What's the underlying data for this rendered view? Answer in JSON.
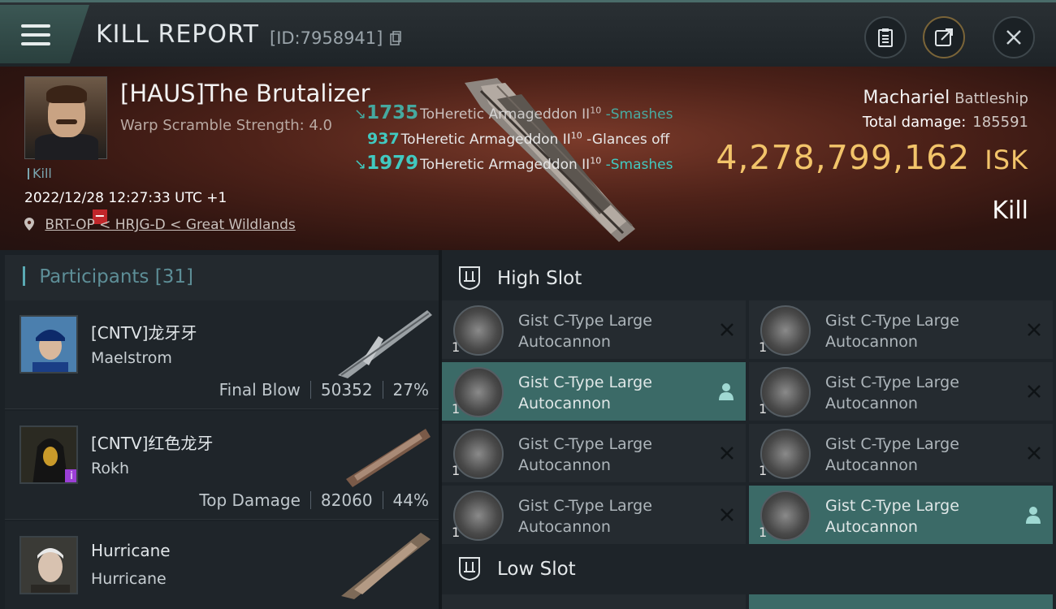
{
  "header": {
    "title": "KILL REPORT",
    "id_label": "[ID:7958941]"
  },
  "victim": {
    "name": "[HAUS]The Brutalizer",
    "subtitle": "Warp Scramble Strength: 4.0",
    "kill_tag": "Kill",
    "timestamp": "2022/12/28 12:27:33 UTC +1",
    "location": "BRT-OP < HRJG-D < Great Wildlands",
    "ship": "Machariel",
    "ship_class": "Battleship",
    "total_damage_label": "Total damage:",
    "total_damage": "185591",
    "isk_value": "4,278,799,162",
    "isk_unit": "ISK",
    "result": "Kill"
  },
  "damage_feed": [
    {
      "amount": "1735",
      "target": "ToHeretic Armageddon II",
      "level": "10",
      "verb": "-Smashes"
    },
    {
      "amount": "937",
      "target": "ToHeretic Armageddon II",
      "level": "10",
      "verb": "-Glances off"
    },
    {
      "amount": "1979",
      "target": "ToHeretic Armageddon II",
      "level": "10",
      "verb": "-Smashes"
    }
  ],
  "participants": {
    "label": "Participants",
    "count": "[31]",
    "rows": [
      {
        "name": "[CNTV]龙牙牙",
        "ship": "Maelstrom",
        "stat_label": "Final Blow",
        "damage": "50352",
        "percent": "27%"
      },
      {
        "name": "[CNTV]红色龙牙",
        "ship": "Rokh",
        "stat_label": "Top Damage",
        "damage": "82060",
        "percent": "44%"
      },
      {
        "name": "Hurricane",
        "ship": "Hurricane",
        "stat_label": "",
        "damage": "",
        "percent": ""
      }
    ]
  },
  "slots": {
    "high_label": "High Slot",
    "low_label": "Low Slot",
    "module_line1": "Gist C-Type Large",
    "module_line2": "Autocannon",
    "module_qty": "1"
  },
  "colors": {
    "accent": "#41c9c0",
    "isk": "#f2c46a",
    "active_module": "#3b6a67"
  }
}
